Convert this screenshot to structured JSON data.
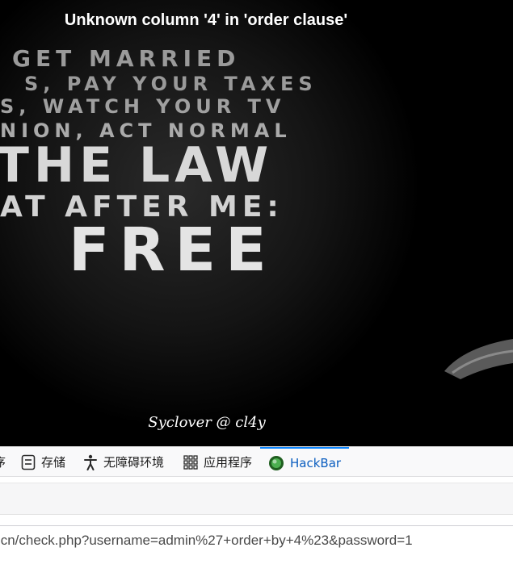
{
  "page": {
    "error_message": "Unknown column '4' in 'order clause'",
    "signature": "Syclover @ cl4y",
    "poster_lines": [
      "GET MARRIED",
      "PAY YOUR TAXES",
      "WATCH YOUR TV",
      "ACT NORMAL",
      "THE LAW",
      "AT AFTER ME:",
      "FREE"
    ]
  },
  "devtools": {
    "tabs": [
      {
        "label": "序",
        "icon": "partial-icon"
      },
      {
        "label": "存储",
        "icon": "storage-icon"
      },
      {
        "label": "无障碍环境",
        "icon": "accessibility-icon"
      },
      {
        "label": "应用程序",
        "icon": "apps-grid-icon"
      },
      {
        "label": "HackBar",
        "icon": "hackbar-icon",
        "active": true
      }
    ],
    "url_value": ".cn/check.php?username=admin%27+order+by+4%23&password=1"
  },
  "colors": {
    "active_tab": "#0a5dbf",
    "background": "#000000"
  }
}
